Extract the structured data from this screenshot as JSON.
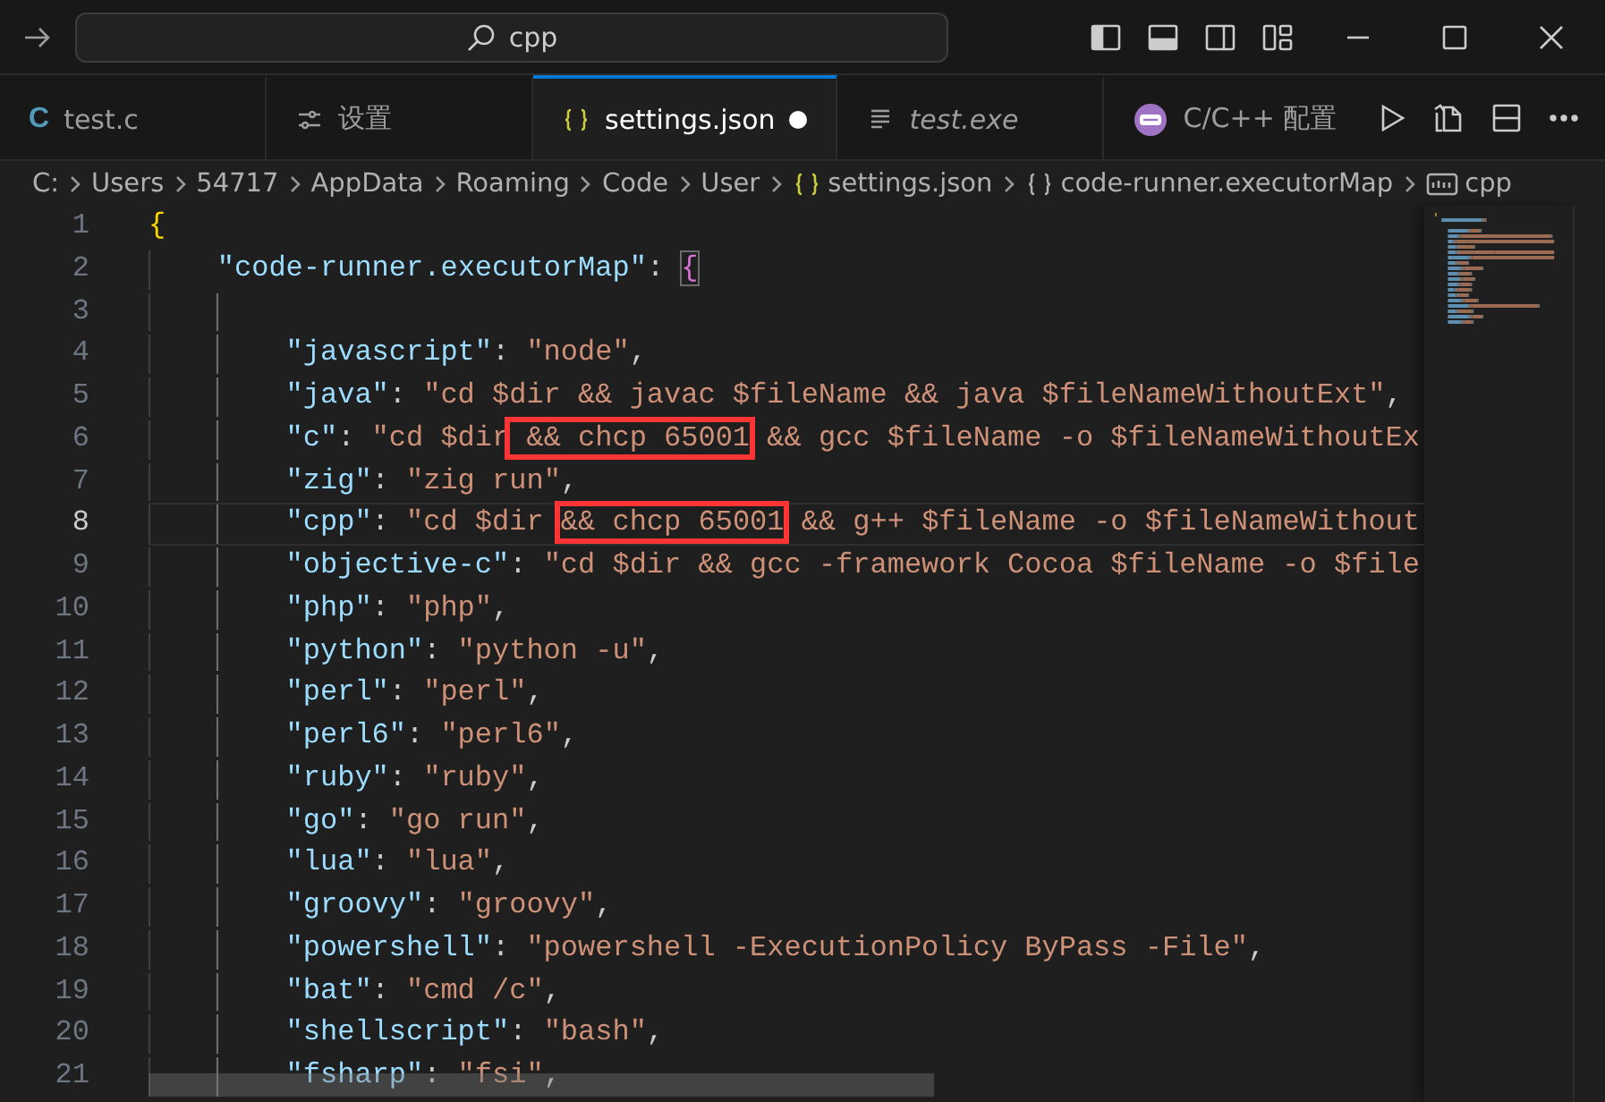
{
  "command_center": {
    "text": "cpp"
  },
  "tabs": [
    {
      "label": "test.c",
      "kind": "c",
      "glyph": "C",
      "selected": false,
      "preview": false,
      "modified": false
    },
    {
      "label": "设置",
      "kind": "settings",
      "selected": false,
      "preview": false,
      "modified": false
    },
    {
      "label": "settings.json",
      "kind": "json",
      "selected": true,
      "preview": false,
      "modified": true
    },
    {
      "label": "test.exe",
      "kind": "file",
      "selected": false,
      "preview": true,
      "modified": false
    },
    {
      "label": "C/C++ 配置",
      "kind": "extension",
      "selected": false,
      "preview": false,
      "modified": false
    }
  ],
  "breadcrumb": [
    {
      "label": "C:",
      "kind": "folder"
    },
    {
      "label": "Users",
      "kind": "folder"
    },
    {
      "label": "54717",
      "kind": "folder"
    },
    {
      "label": "AppData",
      "kind": "folder"
    },
    {
      "label": "Roaming",
      "kind": "folder"
    },
    {
      "label": "Code",
      "kind": "folder"
    },
    {
      "label": "User",
      "kind": "folder"
    },
    {
      "label": "settings.json",
      "kind": "json"
    },
    {
      "label": "code-runner.executorMap",
      "kind": "object"
    },
    {
      "label": "cpp",
      "kind": "string"
    }
  ],
  "lines": [
    {
      "number": "1",
      "current": false,
      "tokens": [
        {
          "kind": "bracket",
          "text": "{"
        }
      ],
      "children": [
        {
          "number": "2",
          "current": false,
          "tokens": [
            {
              "kind": "key",
              "text": "\"code-runner.executorMap\""
            },
            {
              "kind": "punct",
              "text": ": "
            },
            {
              "kind": "bracket-match",
              "text": "{"
            }
          ],
          "children": [
            {
              "number": "3",
              "current": false
            },
            {
              "number": "4",
              "current": false,
              "tokens": [
                {
                  "kind": "key",
                  "text": "\"javascript\""
                },
                {
                  "kind": "punct",
                  "text": ": "
                },
                {
                  "kind": "string",
                  "text": "\"node\""
                },
                {
                  "kind": "punct",
                  "text": ","
                }
              ]
            },
            {
              "number": "5",
              "current": false,
              "tokens": [
                {
                  "kind": "key",
                  "text": "\"java\""
                },
                {
                  "kind": "punct",
                  "text": ": "
                },
                {
                  "kind": "string",
                  "text": "\"cd $dir && javac $fileName && java $fileNameWithoutExt\""
                },
                {
                  "kind": "punct",
                  "text": ","
                }
              ]
            },
            {
              "number": "6",
              "current": false,
              "tokens": [
                {
                  "kind": "key",
                  "text": "\"c\""
                },
                {
                  "kind": "punct",
                  "text": ": "
                },
                {
                  "kind": "string",
                  "text": "\"cd $dir"
                },
                {
                  "kind": "boxed",
                  "text": " && chcp 65001"
                },
                {
                  "kind": "string",
                  "text": " && gcc $fileName -o $fileNameWithoutEx"
                }
              ]
            },
            {
              "number": "7",
              "current": false,
              "tokens": [
                {
                  "kind": "key",
                  "text": "\"zig\""
                },
                {
                  "kind": "punct",
                  "text": ": "
                },
                {
                  "kind": "string",
                  "text": "\"zig run\""
                },
                {
                  "kind": "punct",
                  "text": ","
                }
              ]
            },
            {
              "number": "8",
              "current": true,
              "tokens": [
                {
                  "kind": "key",
                  "text": "\"cpp\""
                },
                {
                  "kind": "punct",
                  "text": ": "
                },
                {
                  "kind": "string",
                  "text": "\"cd $dir "
                },
                {
                  "kind": "boxed",
                  "text": "&& chcp 65001"
                },
                {
                  "kind": "string",
                  "text": " && g++ $fileName -o $fileNameWithout"
                }
              ]
            },
            {
              "number": "9",
              "current": false,
              "tokens": [
                {
                  "kind": "key",
                  "text": "\"objective-c\""
                },
                {
                  "kind": "punct",
                  "text": ": "
                },
                {
                  "kind": "string",
                  "text": "\"cd $dir && gcc -framework Cocoa $fileName -o $file"
                }
              ]
            },
            {
              "number": "10",
              "current": false,
              "tokens": [
                {
                  "kind": "key",
                  "text": "\"php\""
                },
                {
                  "kind": "punct",
                  "text": ": "
                },
                {
                  "kind": "string",
                  "text": "\"php\""
                },
                {
                  "kind": "punct",
                  "text": ","
                }
              ]
            },
            {
              "number": "11",
              "current": false,
              "tokens": [
                {
                  "kind": "key",
                  "text": "\"python\""
                },
                {
                  "kind": "punct",
                  "text": ": "
                },
                {
                  "kind": "string",
                  "text": "\"python -u\""
                },
                {
                  "kind": "punct",
                  "text": ","
                }
              ]
            },
            {
              "number": "12",
              "current": false,
              "tokens": [
                {
                  "kind": "key",
                  "text": "\"perl\""
                },
                {
                  "kind": "punct",
                  "text": ": "
                },
                {
                  "kind": "string",
                  "text": "\"perl\""
                },
                {
                  "kind": "punct",
                  "text": ","
                }
              ]
            },
            {
              "number": "13",
              "current": false,
              "tokens": [
                {
                  "kind": "key",
                  "text": "\"perl6\""
                },
                {
                  "kind": "punct",
                  "text": ": "
                },
                {
                  "kind": "string",
                  "text": "\"perl6\""
                },
                {
                  "kind": "punct",
                  "text": ","
                }
              ]
            },
            {
              "number": "14",
              "current": false,
              "tokens": [
                {
                  "kind": "key",
                  "text": "\"ruby\""
                },
                {
                  "kind": "punct",
                  "text": ": "
                },
                {
                  "kind": "string",
                  "text": "\"ruby\""
                },
                {
                  "kind": "punct",
                  "text": ","
                }
              ]
            },
            {
              "number": "15",
              "current": false,
              "tokens": [
                {
                  "kind": "key",
                  "text": "\"go\""
                },
                {
                  "kind": "punct",
                  "text": ": "
                },
                {
                  "kind": "string",
                  "text": "\"go run\""
                },
                {
                  "kind": "punct",
                  "text": ","
                }
              ]
            },
            {
              "number": "16",
              "current": false,
              "tokens": [
                {
                  "kind": "key",
                  "text": "\"lua\""
                },
                {
                  "kind": "punct",
                  "text": ": "
                },
                {
                  "kind": "string",
                  "text": "\"lua\""
                },
                {
                  "kind": "punct",
                  "text": ","
                }
              ]
            },
            {
              "number": "17",
              "current": false,
              "tokens": [
                {
                  "kind": "key",
                  "text": "\"groovy\""
                },
                {
                  "kind": "punct",
                  "text": ": "
                },
                {
                  "kind": "string",
                  "text": "\"groovy\""
                },
                {
                  "kind": "punct",
                  "text": ","
                }
              ]
            },
            {
              "number": "18",
              "current": false,
              "tokens": [
                {
                  "kind": "key",
                  "text": "\"powershell\""
                },
                {
                  "kind": "punct",
                  "text": ": "
                },
                {
                  "kind": "string",
                  "text": "\"powershell -ExecutionPolicy ByPass -File\""
                },
                {
                  "kind": "punct",
                  "text": ","
                }
              ]
            },
            {
              "number": "19",
              "current": false,
              "tokens": [
                {
                  "kind": "key",
                  "text": "\"bat\""
                },
                {
                  "kind": "punct",
                  "text": ": "
                },
                {
                  "kind": "string",
                  "text": "\"cmd /c\""
                },
                {
                  "kind": "punct",
                  "text": ","
                }
              ]
            },
            {
              "number": "20",
              "current": false,
              "tokens": [
                {
                  "kind": "key",
                  "text": "\"shellscript\""
                },
                {
                  "kind": "punct",
                  "text": ": "
                },
                {
                  "kind": "string",
                  "text": "\"bash\""
                },
                {
                  "kind": "punct",
                  "text": ","
                }
              ]
            },
            {
              "number": "21",
              "current": false,
              "tokens": [
                {
                  "kind": "key",
                  "text": "\"fsharp\""
                },
                {
                  "kind": "punct",
                  "text": ": "
                },
                {
                  "kind": "string",
                  "text": "\"fsi\""
                },
                {
                  "kind": "punct",
                  "text": ","
                }
              ]
            }
          ]
        }
      ]
    }
  ]
}
